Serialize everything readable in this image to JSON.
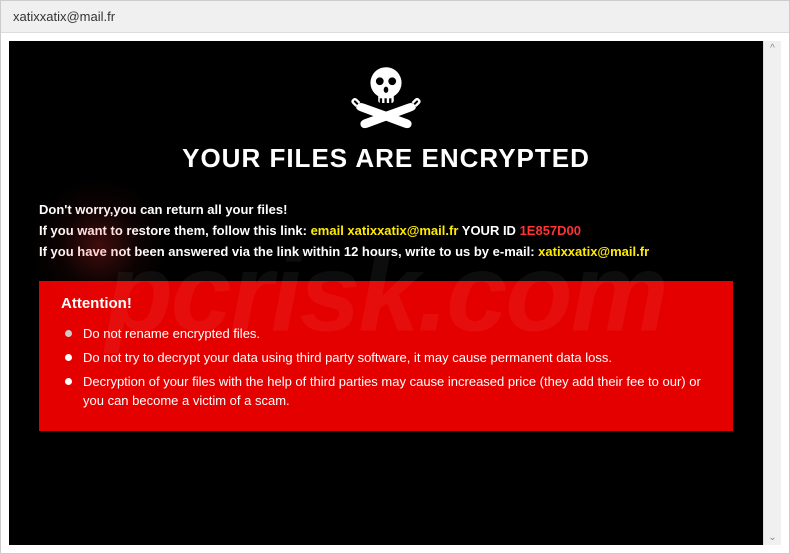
{
  "window": {
    "title": "xatixxatix@mail.fr"
  },
  "main": {
    "heading": "YOUR FILES ARE ENCRYPTED",
    "line1": "Don't worry,you can return all your files!",
    "line2_prefix": "If you want to restore them, follow this link: ",
    "line2_email_label": "email xatixxatix@mail.fr",
    "line2_id_label": "  YOUR ID ",
    "line2_id_value": "1E857D00",
    "line3_prefix": "If you have not been answered via the link within 12 hours, write to us by e-mail: ",
    "line3_email": "xatixxatix@mail.fr"
  },
  "attention": {
    "title": "Attention!",
    "items": [
      "Do not rename encrypted files.",
      "Do not try to decrypt your data using third party software, it may cause permanent data loss.",
      "Decryption of your files with the help of third parties may cause increased price (they add their fee to our) or you can become a victim of a scam."
    ]
  },
  "watermark": "pcrisk.com"
}
